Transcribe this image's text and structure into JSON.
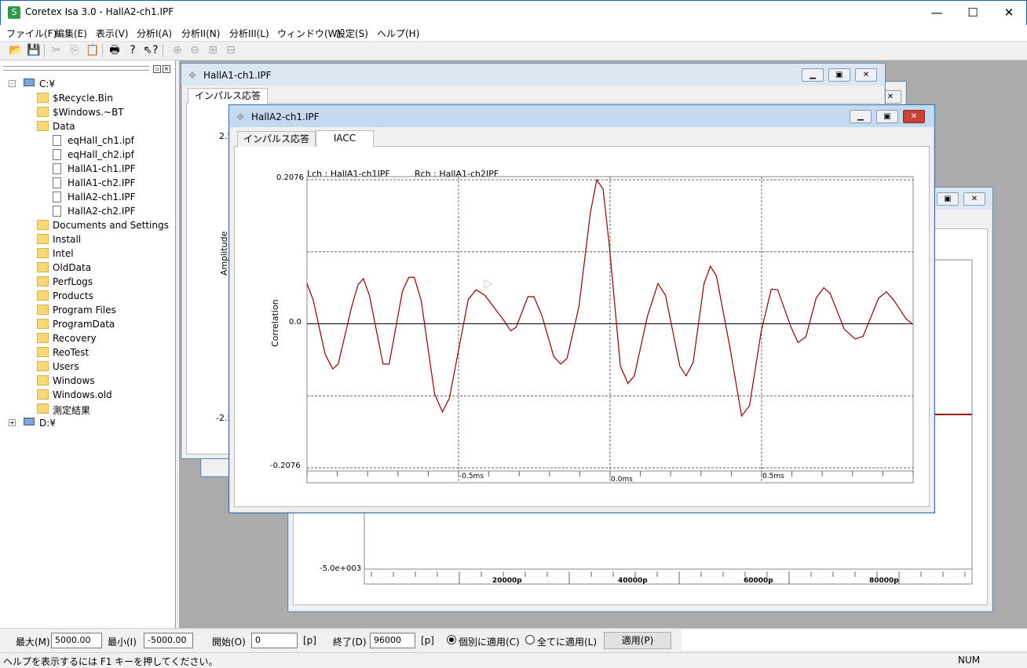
{
  "app": {
    "title": "Coretex Isa 3.0 - HallA2-ch1.IPF",
    "icon": "S"
  },
  "menu": [
    "ファイル(F)",
    "編集(E)",
    "表示(V)",
    "分析I(A)",
    "分析II(N)",
    "分析III(L)",
    "ウィンドウ(W)",
    "設定(S)",
    "ヘルプ(H)"
  ],
  "toolbar": [
    "open-icon",
    "save-icon",
    "cut-icon",
    "copy-icon",
    "paste-icon",
    "print-icon",
    "help-icon",
    "context-help-icon",
    "zoom-in-icon",
    "zoom-out-icon",
    "zoom-fit-icon",
    "zoom-reset-icon"
  ],
  "tree": [
    {
      "label": "C:¥",
      "level": 0,
      "type": "drive",
      "exp": "-"
    },
    {
      "label": "$Recycle.Bin",
      "level": 1,
      "type": "folder",
      "exp": "+"
    },
    {
      "label": "$Windows.~BT",
      "level": 1,
      "type": "folder",
      "exp": "+"
    },
    {
      "label": "Data",
      "level": 1,
      "type": "folder",
      "exp": "-"
    },
    {
      "label": "eqHall_ch1.ipf",
      "level": 2,
      "type": "file"
    },
    {
      "label": "eqHall_ch2.ipf",
      "level": 2,
      "type": "file"
    },
    {
      "label": "HallA1-ch1.IPF",
      "level": 2,
      "type": "file"
    },
    {
      "label": "HallA1-ch2.IPF",
      "level": 2,
      "type": "file"
    },
    {
      "label": "HallA2-ch1.IPF",
      "level": 2,
      "type": "file"
    },
    {
      "label": "HallA2-ch2.IPF",
      "level": 2,
      "type": "file"
    },
    {
      "label": "Documents and Settings",
      "level": 1,
      "type": "folder"
    },
    {
      "label": "Install",
      "level": 1,
      "type": "folder",
      "exp": "+"
    },
    {
      "label": "Intel",
      "level": 1,
      "type": "folder",
      "exp": "+"
    },
    {
      "label": "OldData",
      "level": 1,
      "type": "folder",
      "exp": "+"
    },
    {
      "label": "PerfLogs",
      "level": 1,
      "type": "folder"
    },
    {
      "label": "Products",
      "level": 1,
      "type": "folder",
      "exp": "+"
    },
    {
      "label": "Program Files",
      "level": 1,
      "type": "folder",
      "exp": "+"
    },
    {
      "label": "ProgramData",
      "level": 1,
      "type": "folder",
      "exp": "+"
    },
    {
      "label": "Recovery",
      "level": 1,
      "type": "folder"
    },
    {
      "label": "ReoTest",
      "level": 1,
      "type": "folder",
      "exp": "+"
    },
    {
      "label": "Users",
      "level": 1,
      "type": "folder",
      "exp": "+"
    },
    {
      "label": "Windows",
      "level": 1,
      "type": "folder",
      "exp": "+"
    },
    {
      "label": "Windows.old",
      "level": 1,
      "type": "folder",
      "exp": "+"
    },
    {
      "label": "測定結果",
      "level": 1,
      "type": "folder",
      "exp": "+"
    },
    {
      "label": "D:¥",
      "level": 0,
      "type": "drive",
      "exp": "+"
    }
  ],
  "win_a": {
    "title": "HallA1-ch1.IPF",
    "tab": "インパルス応答",
    "y_top": "2.5",
    "y_bottom": "-2.5",
    "ylabel": "Amplitude"
  },
  "win_c": {
    "y_bottom": "-5.0e+003",
    "x_ticks": [
      "20000p",
      "40000p",
      "60000p",
      "80000p"
    ],
    "line_color": "#a01010"
  },
  "win_b": {
    "title": "HallA2-ch1.IPF",
    "tabs": [
      "インパルス応答",
      "IACC"
    ],
    "active_tab": "IACC"
  },
  "chart_data": {
    "type": "line",
    "lch_label": "Lch : HallA1-ch1IPF",
    "rch_label": "Rch : HallA1-ch2IPF",
    "ylabel": "Correlation",
    "y_ticks": [
      "0.2076",
      "0.0",
      "-0.2076"
    ],
    "x_ticks": [
      "-0.5ms",
      "0.0ms",
      "0.5ms"
    ],
    "xlim": [
      -1.0,
      1.0
    ],
    "ylim": [
      -0.2076,
      0.2076
    ],
    "grid": true,
    "color": "#8b0000",
    "x": [
      -1.0,
      -0.98,
      -0.94,
      -0.915,
      -0.897,
      -0.853,
      -0.832,
      -0.814,
      -0.794,
      -0.749,
      -0.729,
      -0.685,
      -0.664,
      -0.646,
      -0.623,
      -0.579,
      -0.553,
      -0.53,
      -0.468,
      -0.442,
      -0.413,
      -0.354,
      -0.328,
      -0.31,
      -0.271,
      -0.251,
      -0.225,
      -0.186,
      -0.163,
      -0.142,
      -0.103,
      -0.065,
      -0.044,
      -0.023,
      -0.003,
      0.034,
      0.059,
      0.08,
      0.124,
      0.158,
      0.183,
      0.23,
      0.251,
      0.274,
      0.31,
      0.331,
      0.351,
      0.395,
      0.434,
      0.46,
      0.499,
      0.532,
      0.553,
      0.597,
      0.62,
      0.646,
      0.68,
      0.705,
      0.726,
      0.773,
      0.809,
      0.835,
      0.886,
      0.912,
      0.938,
      0.977,
      0.995
    ],
    "y": [
      0.058,
      0.035,
      -0.044,
      -0.065,
      -0.058,
      0.024,
      0.056,
      0.065,
      0.041,
      -0.058,
      -0.058,
      0.047,
      0.067,
      0.067,
      0.033,
      -0.101,
      -0.127,
      -0.107,
      0.035,
      0.049,
      0.041,
      0.007,
      -0.01,
      -0.005,
      0.039,
      0.039,
      0.012,
      -0.047,
      -0.058,
      -0.05,
      0.024,
      0.16,
      0.2076,
      0.194,
      0.115,
      -0.061,
      -0.086,
      -0.075,
      0.012,
      0.058,
      0.041,
      -0.061,
      -0.075,
      -0.056,
      0.058,
      0.083,
      0.069,
      -0.033,
      -0.133,
      -0.118,
      -0.01,
      0.05,
      0.049,
      -0.005,
      -0.027,
      -0.019,
      0.037,
      0.052,
      0.044,
      -0.008,
      -0.022,
      -0.018,
      0.037,
      0.046,
      0.033,
      0.007,
      0.001
    ]
  },
  "bottom": {
    "max_label": "最大(M)",
    "max_value": "5000.00",
    "min_label": "最小(I)",
    "min_value": "-5000.00",
    "start_label": "開始(O)",
    "start_value": "0",
    "unit": "[p]",
    "end_label": "終了(D)",
    "end_value": "96000",
    "radio_individual": "個別に適用(C)",
    "radio_all": "全てに適用(L)",
    "apply": "適用(P)",
    "selected": "individual"
  },
  "status": {
    "help": "ヘルプを表示するには F1 キーを押してください。",
    "num": "NUM"
  }
}
